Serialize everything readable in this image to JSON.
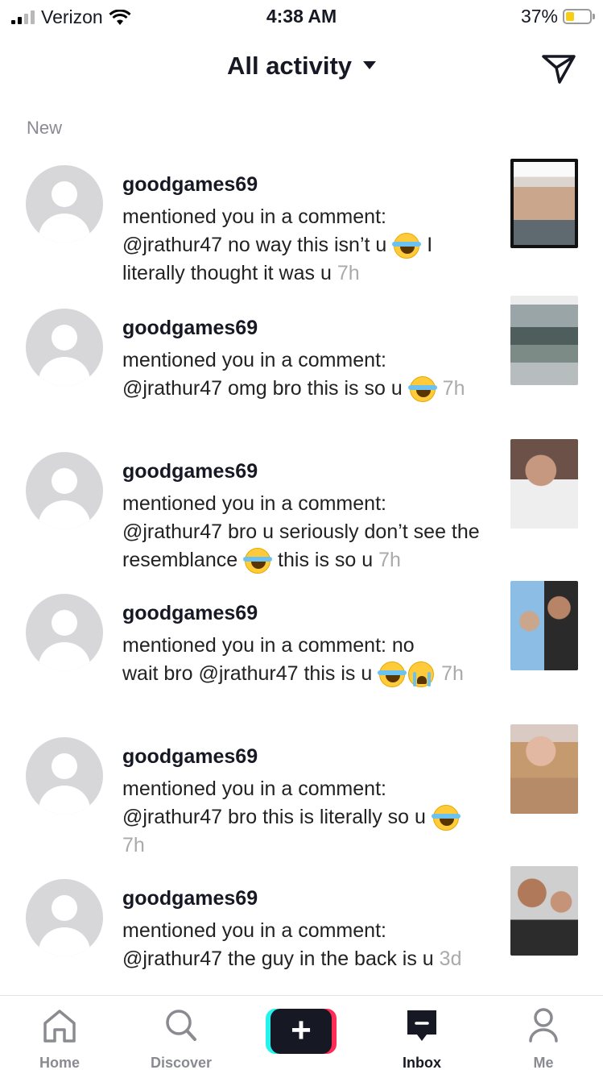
{
  "status_bar": {
    "carrier": "Verizon",
    "time": "4:38 AM",
    "battery": "37%",
    "battery_level": 0.37
  },
  "header": {
    "title": "All activity"
  },
  "section": {
    "label": "New"
  },
  "notifications": [
    {
      "user": "goodgames69",
      "action": "mentioned you in a comment:",
      "text": "@jrathur47 no way this isn’t u",
      "emoji": [
        "joy"
      ],
      "tail": " I literally thought it was u",
      "time": "7h"
    },
    {
      "user": "goodgames69",
      "action": "mentioned you in a comment:",
      "text": "@jrathur47 omg bro this is so u",
      "emoji": [
        "joy"
      ],
      "tail": "",
      "time": "7h"
    },
    {
      "user": "goodgames69",
      "action": "mentioned you in a comment:",
      "text": "@jrathur47 bro u seriously don’t see the resemblance",
      "emoji": [
        "joy"
      ],
      "tail": " this is so u",
      "time": "7h"
    },
    {
      "user": "goodgames69",
      "action": "mentioned you in a comment: no",
      "text": "wait bro @jrathur47 this is u",
      "emoji": [
        "joy",
        "sob"
      ],
      "tail": "",
      "time": "7h"
    },
    {
      "user": "goodgames69",
      "action": "mentioned you in a comment:",
      "text": "@jrathur47 bro this is literally so u",
      "emoji": [
        "joy"
      ],
      "tail": "",
      "time": "7h"
    },
    {
      "user": "goodgames69",
      "action": "mentioned you in a comment:",
      "text": "@jrathur47 the guy in the back is u",
      "emoji": [],
      "tail": "",
      "time": "3d"
    }
  ],
  "tabs": [
    {
      "label": "Home",
      "icon": "home-icon"
    },
    {
      "label": "Discover",
      "icon": "search-icon"
    },
    {
      "label": "",
      "icon": "plus-icon"
    },
    {
      "label": "Inbox",
      "icon": "inbox-icon"
    },
    {
      "label": "Me",
      "icon": "profile-icon"
    }
  ]
}
